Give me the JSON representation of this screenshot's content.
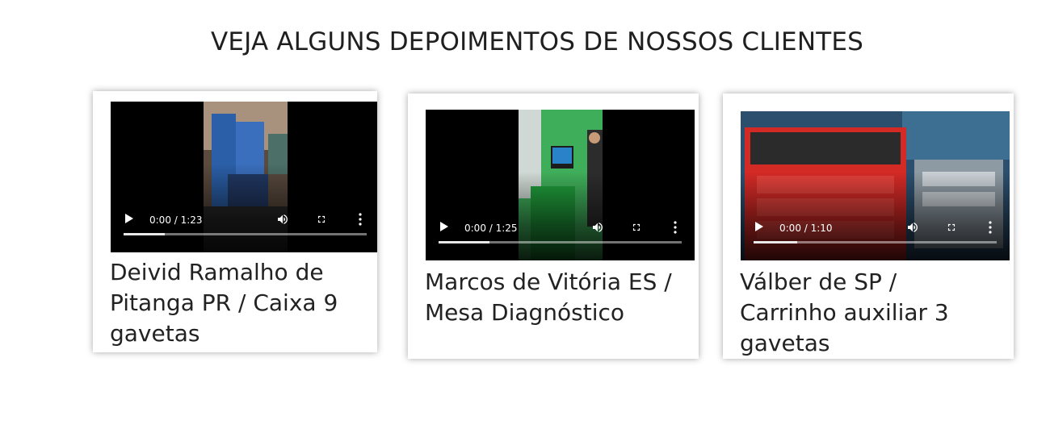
{
  "section": {
    "title": "VEJA ALGUNS DEPOIMENTOS DE NOSSOS CLIENTES"
  },
  "testimonials": [
    {
      "caption": "Deivid Ramalho de Pitanga PR / Caixa 9 gavetas",
      "time": "0:00 / 1:23",
      "progress": 0.17,
      "thumbnail": "blue-toolbox-portrait-frame"
    },
    {
      "caption": "Marcos de Vitória ES / Mesa Diagnóstico",
      "time": "0:00 / 1:25",
      "progress": 0.21,
      "thumbnail": "green-diagnostic-desk-portrait-frame"
    },
    {
      "caption": "Válber de SP / Carrinho auxiliar 3 gavetas",
      "time": "0:00 / 1:10",
      "progress": 0.18,
      "thumbnail": "red-tool-cart-landscape-frame"
    }
  ],
  "icons": {
    "play": "play-icon",
    "volume": "volume-icon",
    "fullscreen": "fullscreen-icon",
    "more": "more-vert-icon"
  },
  "colors": {
    "title": "#1f1f1f",
    "text": "#222222",
    "video_bg": "#000000",
    "card_bg": "#ffffff"
  }
}
